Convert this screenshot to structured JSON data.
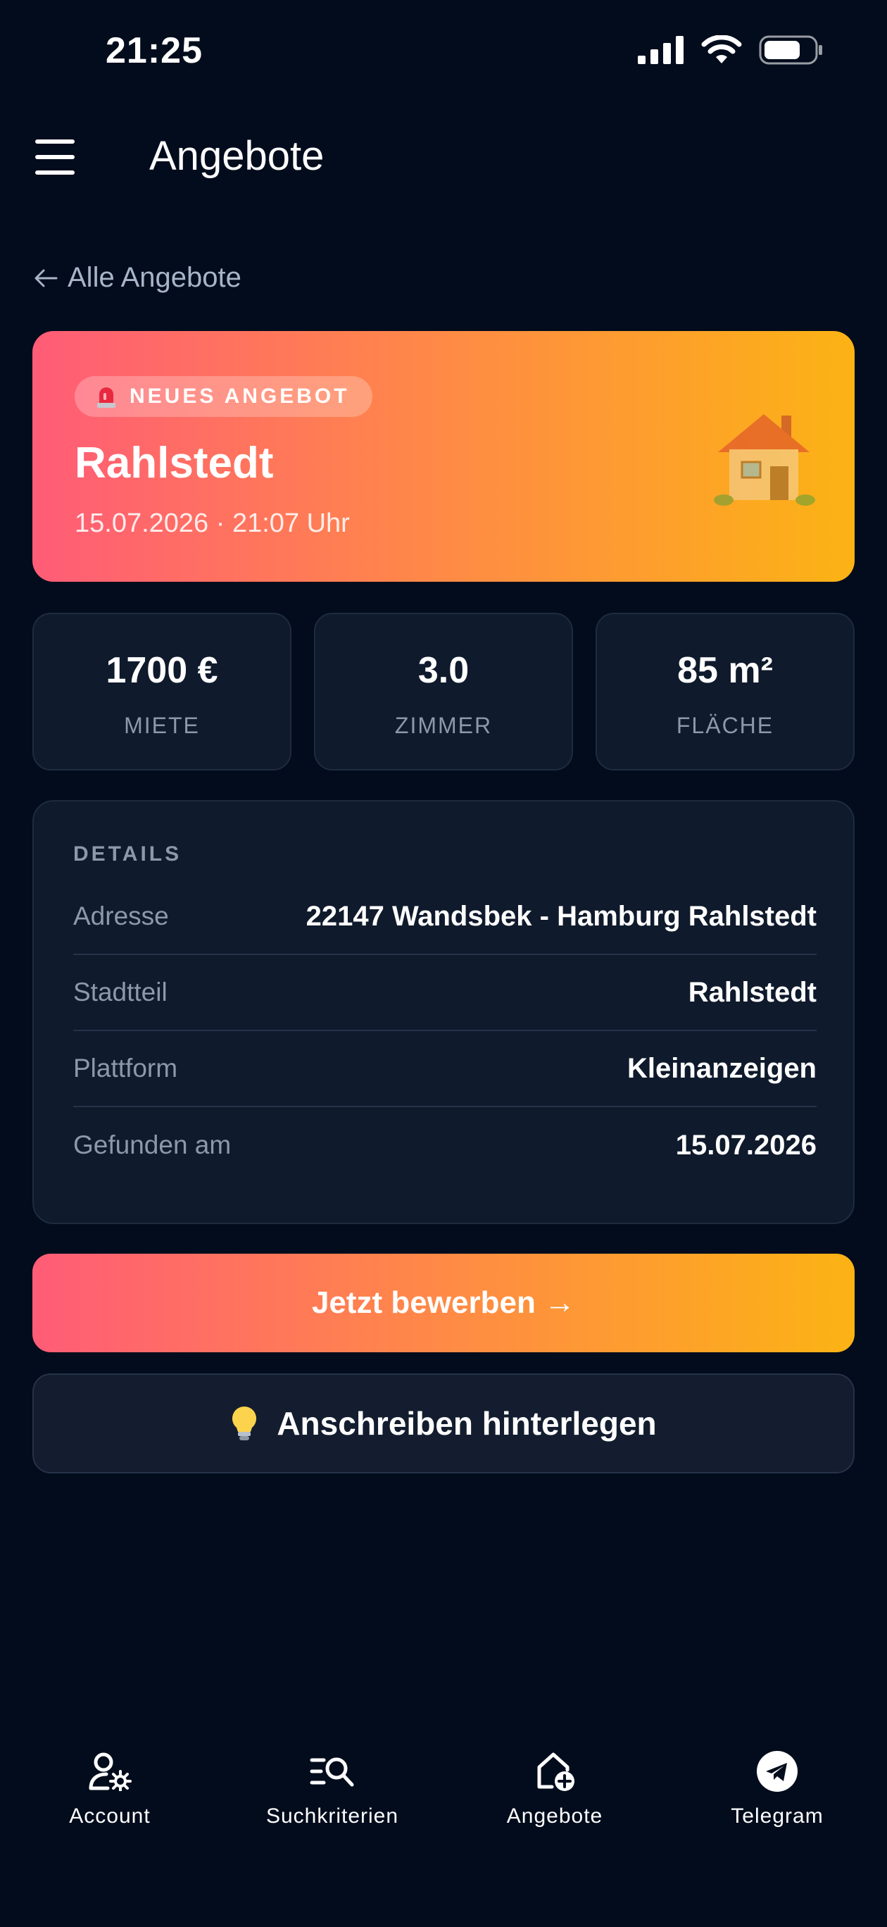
{
  "status_bar": {
    "time": "21:25"
  },
  "header": {
    "title": "Angebote"
  },
  "back_link": {
    "label": "Alle Angebote"
  },
  "hero": {
    "badge": "NEUES ANGEBOT",
    "title": "Rahlstedt",
    "date": "15.07.2026 · 21:07 Uhr"
  },
  "stats": [
    {
      "value": "1700 €",
      "label": "MIETE"
    },
    {
      "value": "3.0",
      "label": "ZIMMER"
    },
    {
      "value": "85 m²",
      "label": "FLÄCHE"
    }
  ],
  "details": {
    "heading": "DETAILS",
    "rows": [
      {
        "label": "Adresse",
        "value": "22147 Wandsbek - Hamburg Rahlstedt"
      },
      {
        "label": "Stadtteil",
        "value": "Rahlstedt"
      },
      {
        "label": "Plattform",
        "value": "Kleinanzeigen"
      },
      {
        "label": "Gefunden am",
        "value": "15.07.2026"
      }
    ]
  },
  "actions": {
    "apply_label": "Jetzt bewerben →",
    "cover_letter_label": "Anschreiben hinterlegen"
  },
  "bottom_nav": [
    {
      "label": "Account",
      "icon": "account-settings-icon"
    },
    {
      "label": "Suchkriterien",
      "icon": "search-criteria-icon"
    },
    {
      "label": "Angebote",
      "icon": "home-add-icon"
    },
    {
      "label": "Telegram",
      "icon": "telegram-icon"
    }
  ],
  "colors": {
    "background": "#020c1c",
    "card": "#0f1a2c",
    "gradient_start": "#ff5c77",
    "gradient_end": "#fcb314",
    "muted_text": "#8c98ab"
  }
}
